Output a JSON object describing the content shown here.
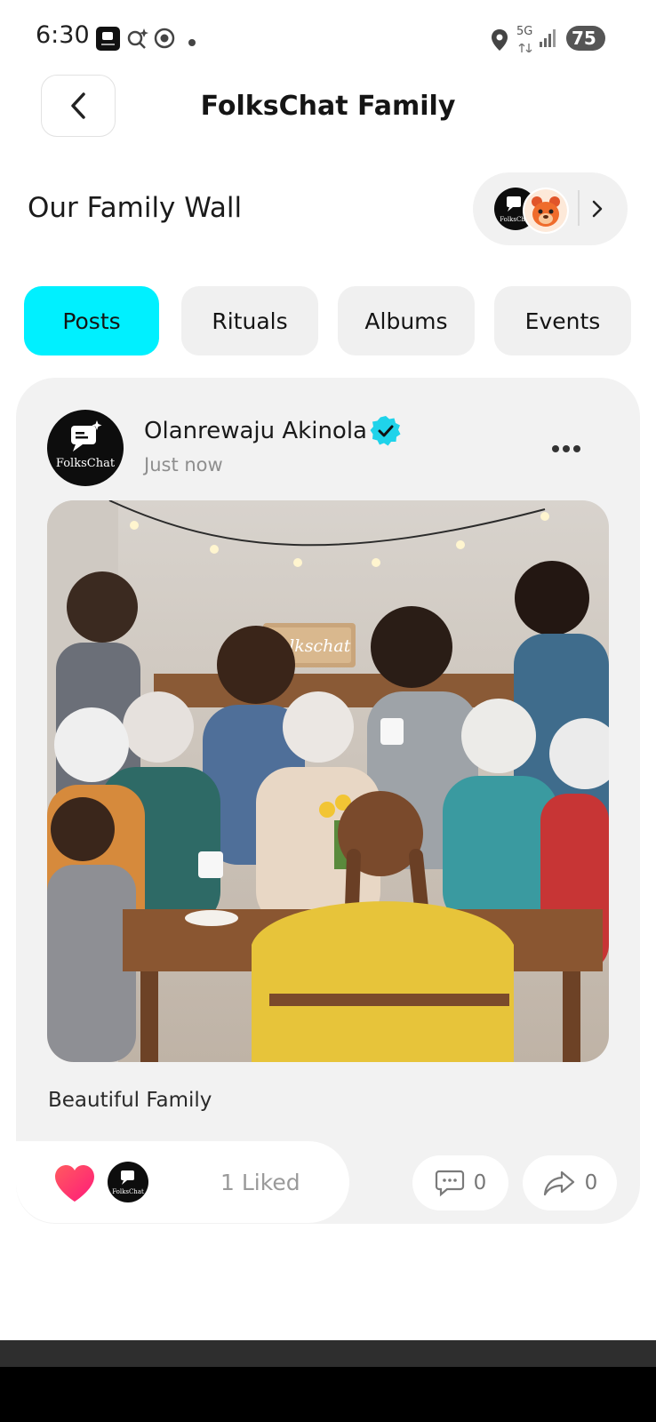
{
  "status_bar": {
    "time": "6:30",
    "network": "5G",
    "battery": "75"
  },
  "header": {
    "back_icon": "chevron-left-icon",
    "title": "FolksChat Family"
  },
  "wall": {
    "title": "Our Family Wall"
  },
  "tabs": [
    {
      "label": "Posts",
      "active": true
    },
    {
      "label": "Rituals",
      "active": false
    },
    {
      "label": "Albums",
      "active": false
    },
    {
      "label": "Events",
      "active": false
    }
  ],
  "post": {
    "author": "Olanrewaju Akinola",
    "time": "Just now",
    "avatar_logo_text": "FolksChat",
    "photo_sign_text": "Folkschat",
    "caption": "Beautiful Family",
    "liked_text": "1 Liked",
    "comment_count": "0",
    "share_count": "0"
  },
  "colors": {
    "accent": "#00F0FF",
    "verified": "#1FD3EA",
    "heart": "#FF2E63"
  }
}
